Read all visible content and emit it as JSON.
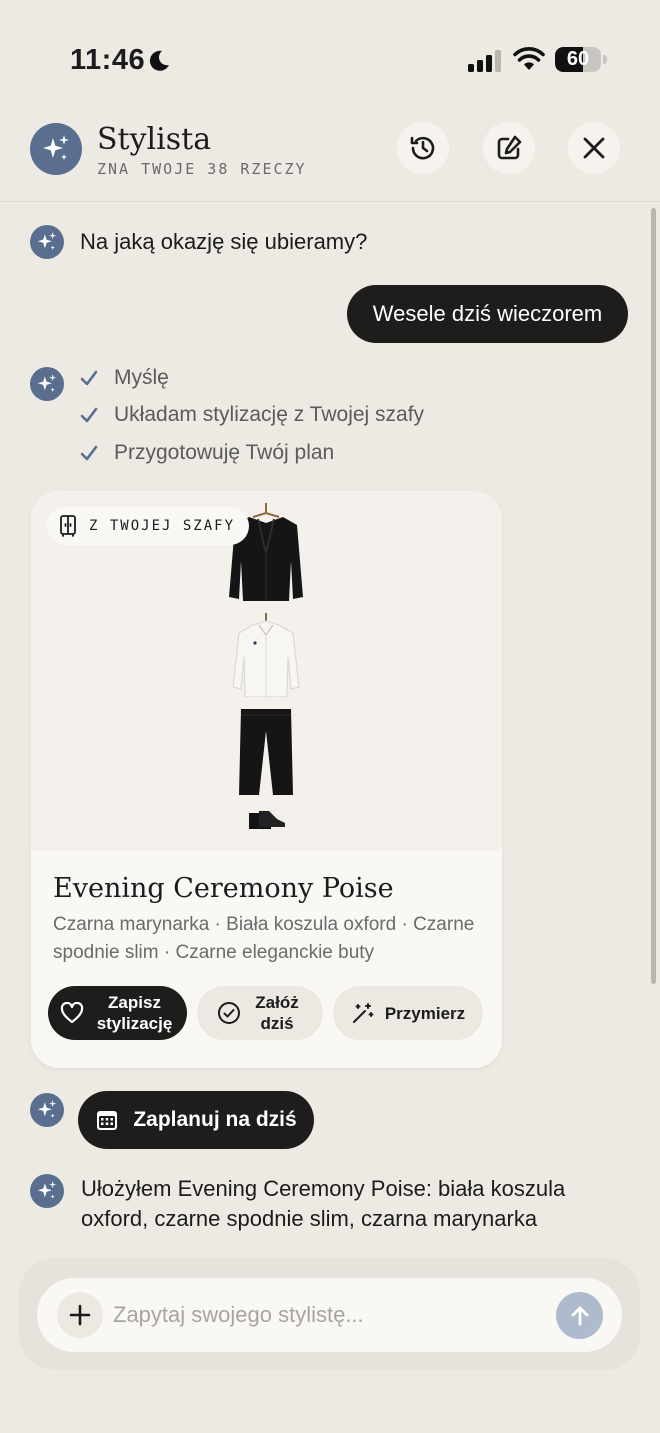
{
  "status_bar": {
    "time": "11:46",
    "battery": "60",
    "battery_level_percent": 60,
    "icons": [
      "moon-icon",
      "signal-icon",
      "wifi-icon",
      "battery-icon"
    ]
  },
  "header": {
    "title": "Stylista",
    "subtitle": "ZNA TWOJE 38 RZECZY",
    "buttons": [
      "history-icon",
      "compose-icon",
      "close-icon"
    ]
  },
  "chat": {
    "ai_question": "Na jaką okazję się ubieramy?",
    "user_message": "Wesele dziś wieczorem",
    "steps": [
      {
        "label": "Myślę"
      },
      {
        "label": "Układam stylizację z Twojej szafy"
      },
      {
        "label": "Przygotowuję Twój plan"
      }
    ],
    "outfit_card": {
      "source_label": "Z TWOJEJ SZAFY",
      "name": "Evening Ceremony Poise",
      "items_text": "Czarna marynarka · Biała koszula oxford · Czarne spodnie slim · Czarne eleganckie buty",
      "items_icons": [
        "blazer-image",
        "shirt-image",
        "trousers-image",
        "shoes-image"
      ],
      "actions": {
        "save": "Zapisz stylizację",
        "wear": "Załóż dziś",
        "try_on": "Przymierz"
      }
    },
    "plan_button": "Zaplanuj na dziś",
    "summary": "Ułożyłem Evening Ceremony Poise: biała koszula oxford, czarne spodnie slim, czarna marynarka"
  },
  "composer": {
    "placeholder": "Zapytaj swojego stylistę..."
  },
  "colors": {
    "background": "#ede9e3",
    "accent": "#5a6f8f",
    "dark_button": "#1f1d1b",
    "send_disabled": "#aebbcc",
    "check": "#5a6f8f"
  }
}
